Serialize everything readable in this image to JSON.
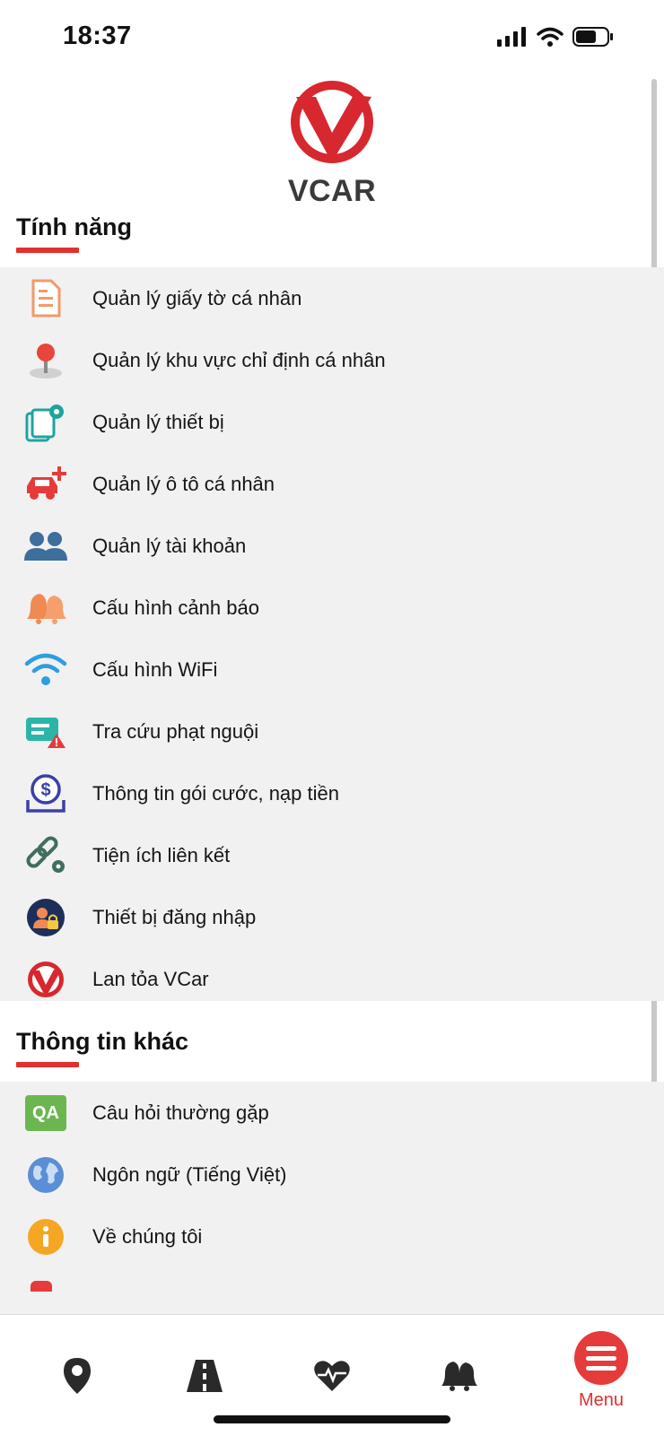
{
  "status_bar": {
    "time": "18:37"
  },
  "brand": {
    "name": "VCAR",
    "accent": "#e03030"
  },
  "features": {
    "title": "Tính năng",
    "items": [
      {
        "label": "Quản lý giấy tờ cá nhân",
        "icon": "document-icon"
      },
      {
        "label": "Quản lý khu vực chỉ định cá nhân",
        "icon": "map-pin-icon"
      },
      {
        "label": "Quản lý thiết bị",
        "icon": "device-settings-icon"
      },
      {
        "label": "Quản lý ô tô cá nhân",
        "icon": "car-add-icon"
      },
      {
        "label": "Quản lý tài khoản",
        "icon": "users-icon"
      },
      {
        "label": "Cấu hình cảnh báo",
        "icon": "alert-bells-icon"
      },
      {
        "label": "Cấu hình WiFi",
        "icon": "wifi-icon"
      },
      {
        "label": "Tra cứu phạt nguội",
        "icon": "fine-lookup-icon"
      },
      {
        "label": "Thông tin gói cước, nạp tiền",
        "icon": "payment-icon"
      },
      {
        "label": "Tiện ích liên kết",
        "icon": "link-settings-icon"
      },
      {
        "label": "Thiết bị đăng nhập",
        "icon": "login-device-icon"
      },
      {
        "label": "Lan tỏa VCar",
        "icon": "vcar-logo-icon"
      }
    ]
  },
  "other_info": {
    "title": "Thông tin khác",
    "items": [
      {
        "label": "Câu hỏi thường gặp",
        "icon": "qa-icon",
        "badge": "QA"
      },
      {
        "label": "Ngôn ngữ (Tiếng Việt)",
        "icon": "globe-icon"
      },
      {
        "label": "Về chúng tôi",
        "icon": "info-icon"
      }
    ]
  },
  "bottom_nav": {
    "items": [
      {
        "name": "location",
        "icon": "location-pin-icon"
      },
      {
        "name": "road",
        "icon": "road-icon"
      },
      {
        "name": "health",
        "icon": "heartbeat-icon"
      },
      {
        "name": "alerts",
        "icon": "bells-icon"
      },
      {
        "name": "menu",
        "icon": "menu-icon",
        "label": "Menu"
      }
    ]
  }
}
